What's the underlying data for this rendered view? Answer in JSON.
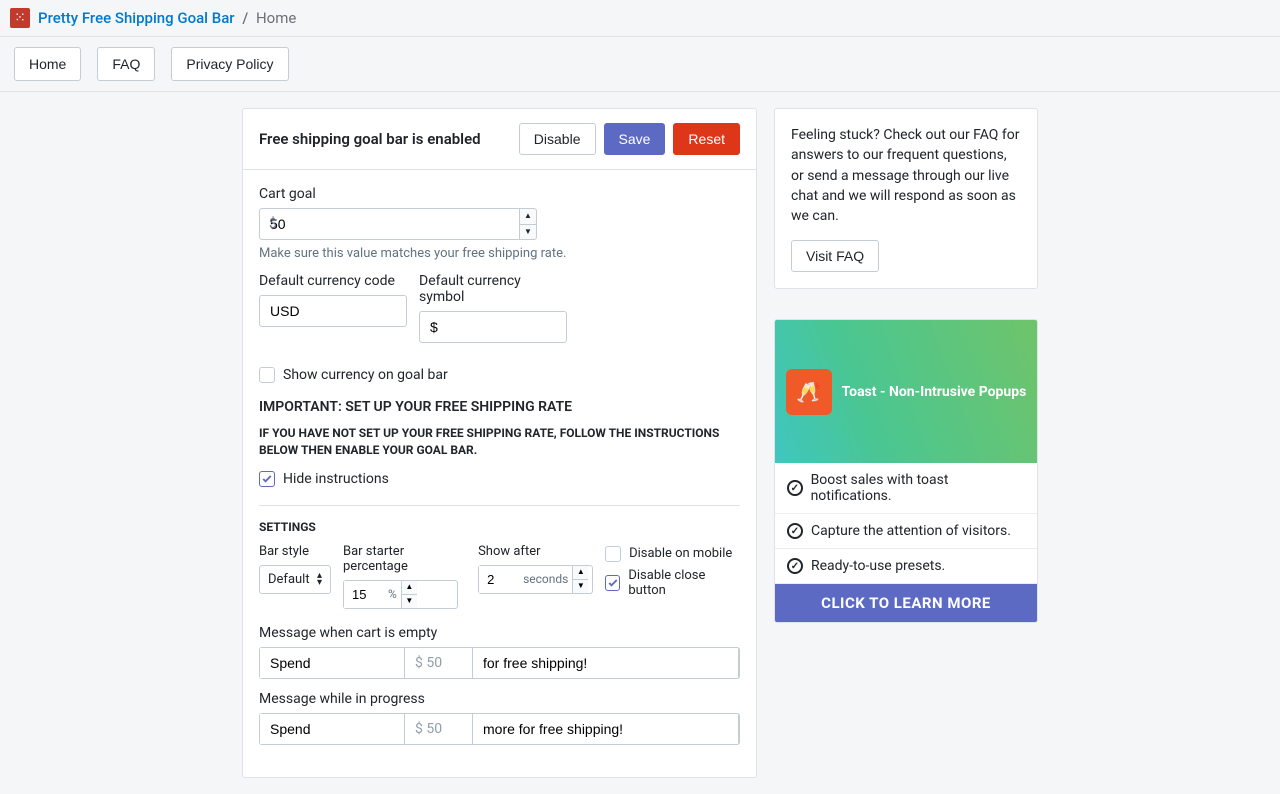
{
  "app": {
    "name": "Pretty Free Shipping Goal Bar",
    "breadcrumb_current": "Home"
  },
  "nav": {
    "home": "Home",
    "faq": "FAQ",
    "privacy": "Privacy Policy"
  },
  "panel": {
    "title": "Free shipping goal bar is enabled",
    "disable": "Disable",
    "save": "Save",
    "reset": "Reset"
  },
  "cart": {
    "goal_label": "Cart goal",
    "goal_value": "50",
    "currency_prefix": "$",
    "goal_help": "Make sure this value matches your free shipping rate.",
    "code_label": "Default currency code",
    "code_value": "USD",
    "symbol_label": "Default currency symbol",
    "symbol_value": "$",
    "show_currency_label": "Show currency on goal bar"
  },
  "important": {
    "heading": "IMPORTANT: SET UP YOUR FREE SHIPPING RATE",
    "body": "IF YOU HAVE NOT SET UP YOUR FREE SHIPPING RATE, FOLLOW THE INSTRUCTIONS BELOW THEN ENABLE YOUR GOAL BAR.",
    "hide_label": "Hide instructions"
  },
  "settings": {
    "heading": "SETTINGS",
    "bar_style_label": "Bar style",
    "bar_style_value": "Default",
    "starter_pct_label": "Bar starter percentage",
    "starter_pct_value": "15",
    "starter_pct_unit": "%",
    "show_after_label": "Show after",
    "show_after_value": "2",
    "show_after_unit": "seconds",
    "disable_mobile_label": "Disable on mobile",
    "disable_close_label": "Disable close button"
  },
  "messages": {
    "empty_label": "Message when cart is empty",
    "empty_pre": "Spend",
    "empty_amount": "$ 50",
    "empty_post": "for free shipping!",
    "progress_label": "Message while in progress",
    "progress_pre": "Spend",
    "progress_amount": "$ 50",
    "progress_post": "more for free shipping!"
  },
  "help_card": {
    "text": "Feeling stuck? Check out our FAQ for answers to our frequent questions, or send a message through our live chat and we will respond as soon as we can.",
    "button": "Visit FAQ"
  },
  "promo": {
    "title": "Toast - Non-Intrusive Popups",
    "items": [
      "Boost sales with toast notifications.",
      "Capture the attention of visitors.",
      "Ready-to-use presets."
    ],
    "cta": "CLICK TO LEARN MORE"
  }
}
